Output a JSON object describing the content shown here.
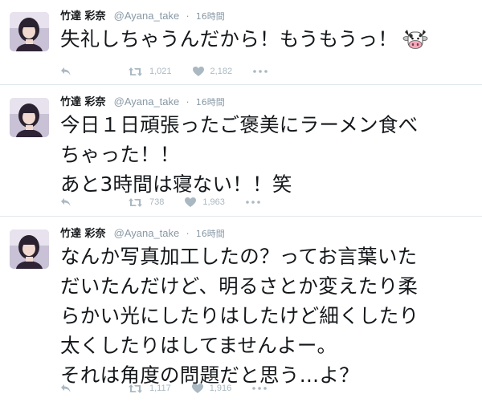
{
  "tweets": [
    {
      "name": "竹達 彩奈",
      "handle": "@Ayana_take",
      "separator": "·",
      "time": "16時間",
      "text": "失礼しちゃうんだから！もうもうっ！",
      "emoji": "cow-face-icon",
      "retweets": "1,021",
      "likes": "2,182"
    },
    {
      "name": "竹達 彩奈",
      "handle": "@Ayana_take",
      "separator": "·",
      "time": "16時間",
      "text": "今日１日頑張ったご褒美にラーメン食べ\nちゃった！！\nあと3時間は寝ない！！笑",
      "retweets": "738",
      "likes": "1,963"
    },
    {
      "name": "竹達 彩奈",
      "handle": "@Ayana_take",
      "separator": "·",
      "time": "16時間",
      "text": "なんか写真加工したの？ってお言葉いた\nだいたんだけど、明るさとか変えたり柔\nらかい光にしたりはしたけど細くしたり\n太くしたりはしてませんよー。\nそれは角度の問題だと思う…よ？",
      "retweets": "1,117",
      "likes": "1,916"
    }
  ],
  "colors": {
    "text": "#14171a",
    "muted": "#8899a6",
    "icon": "#aab8c2",
    "divider": "#e1e8ed"
  }
}
